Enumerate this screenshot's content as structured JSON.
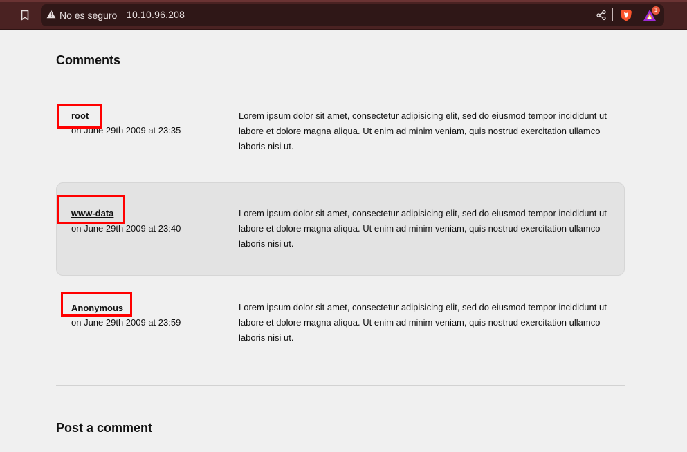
{
  "browser": {
    "security_label": "No es seguro",
    "url": "10.10.96.208",
    "rewards_count": "1",
    "icons": {
      "bookmark": "bookmark-icon",
      "warning": "warning-icon",
      "share": "share-icon",
      "brave": "brave-shield-icon",
      "rewards": "brave-rewards-icon"
    }
  },
  "page": {
    "comments_heading": "Comments",
    "post_heading": "Post a comment",
    "comments": [
      {
        "author": "root",
        "date": "on June 29th 2009 at 23:35",
        "body": "Lorem ipsum dolor sit amet, consectetur adipisicing elit, sed do eiusmod tempor incididunt ut labore et dolore magna aliqua. Ut enim ad minim veniam, quis nostrud exercitation ullamco laboris nisi ut."
      },
      {
        "author": "www-data",
        "date": "on June 29th 2009 at 23:40",
        "body": "Lorem ipsum dolor sit amet, consectetur adipisicing elit, sed do eiusmod tempor incididunt ut labore et dolore magna aliqua. Ut enim ad minim veniam, quis nostrud exercitation ullamco laboris nisi ut."
      },
      {
        "author": "Anonymous",
        "date": "on June 29th 2009 at 23:59",
        "body": "Lorem ipsum dolor sit amet, consectetur adipisicing elit, sed do eiusmod tempor incididunt ut labore et dolore magna aliqua. Ut enim ad minim veniam, quis nostrud exercitation ullamco laboris nisi ut."
      }
    ]
  },
  "colors": {
    "chrome_bg": "#4a2222",
    "urlbar_bg": "#2f1717",
    "page_bg": "#f0f0f0",
    "alt_row_bg": "#e3e3e3",
    "highlight": "#ff0000"
  }
}
